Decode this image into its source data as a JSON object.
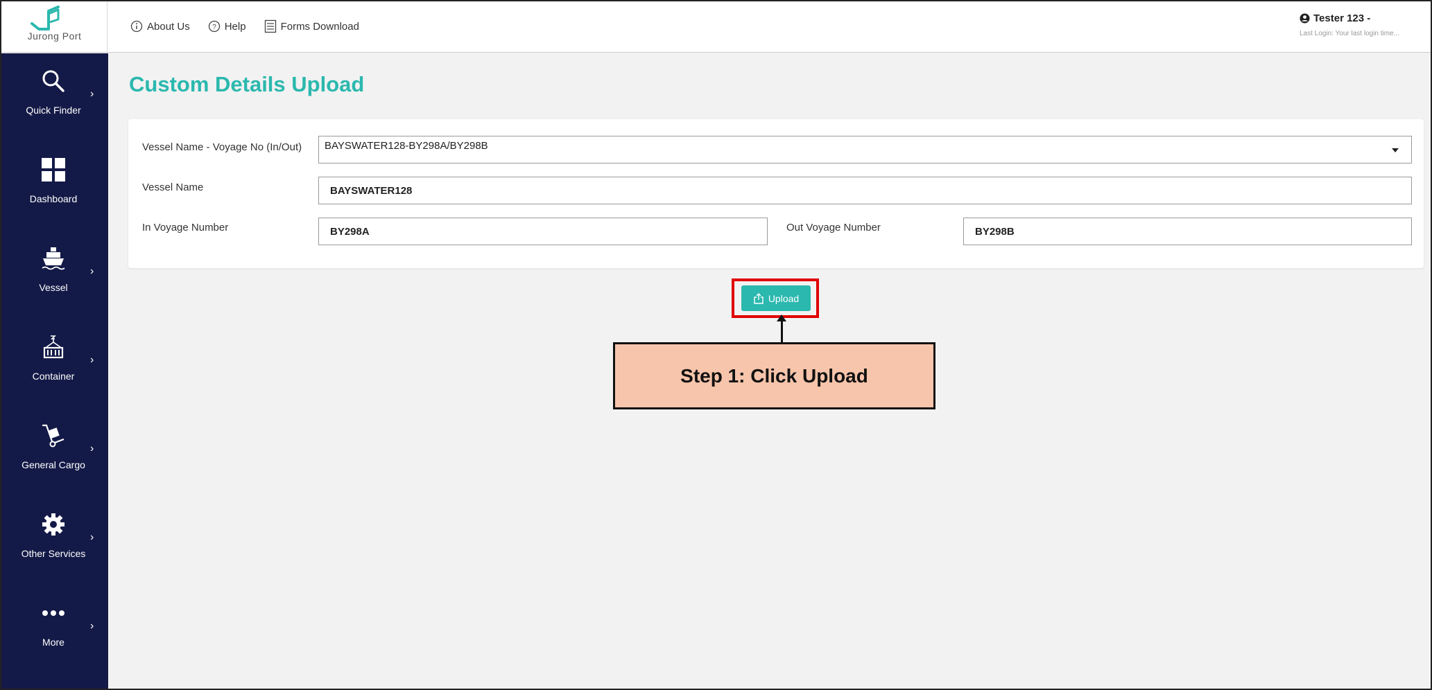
{
  "brand": {
    "name": "Jurong Port",
    "color": "#2bb8ae"
  },
  "topnav": {
    "about": "About Us",
    "help": "Help",
    "forms": "Forms Download"
  },
  "user": {
    "name": "Tester 123 -",
    "last_login": "Last Login: Your last login time..."
  },
  "sidebar": {
    "items": [
      {
        "label": "Quick Finder",
        "icon": "search-icon"
      },
      {
        "label": "Dashboard",
        "icon": "grid-icon"
      },
      {
        "label": "Vessel",
        "icon": "ship-icon"
      },
      {
        "label": "Container",
        "icon": "crane-container-icon"
      },
      {
        "label": "General Cargo",
        "icon": "hand-truck-icon"
      },
      {
        "label": "Other Services",
        "icon": "gear-icon"
      },
      {
        "label": "More",
        "icon": "more-dots-icon"
      }
    ]
  },
  "page": {
    "title": "Custom Details Upload"
  },
  "form": {
    "vessel_voyage_label": "Vessel Name - Voyage No (In/Out)",
    "vessel_voyage_value": "BAYSWATER128-BY298A/BY298B",
    "vessel_name_label": "Vessel Name",
    "vessel_name_value": "BAYSWATER128",
    "in_voyage_label": "In Voyage Number",
    "in_voyage_value": "BY298A",
    "out_voyage_label": "Out Voyage Number",
    "out_voyage_value": "BY298B"
  },
  "upload": {
    "label": "Upload"
  },
  "annotation": {
    "text": "Step 1: Click Upload",
    "highlight_color": "#e00000",
    "callout_color": "#f7c5ab"
  }
}
